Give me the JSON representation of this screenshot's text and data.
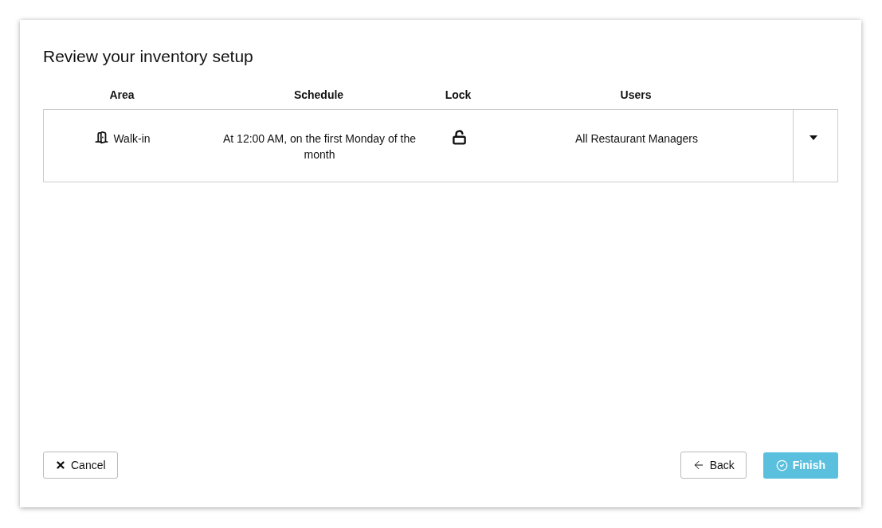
{
  "title": "Review your inventory setup",
  "table": {
    "columns": [
      "Area",
      "Schedule",
      "Lock",
      "Users"
    ],
    "rows": [
      {
        "area": "Walk-in",
        "schedule": "At 12:00 AM, on the first Monday of the month",
        "locked": false,
        "users": "All Restaurant Managers",
        "expanded": false
      }
    ]
  },
  "footer": {
    "cancel": "Cancel",
    "back": "Back",
    "finish": {
      "label": "Finish",
      "disabled": true
    }
  }
}
